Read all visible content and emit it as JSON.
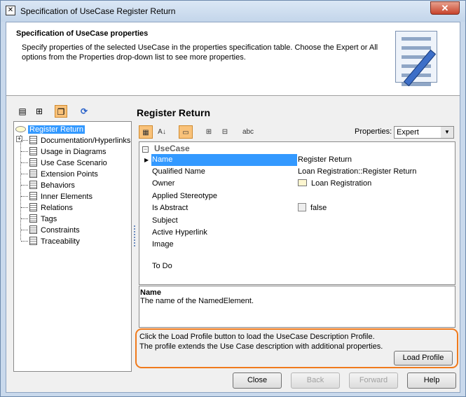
{
  "window": {
    "title": "Specification of UseCase Register Return",
    "close_label": "✕"
  },
  "header": {
    "title": "Specification of UseCase properties",
    "description": "Specify properties of the selected UseCase in the properties specification table. Choose the Expert or All options from the Properties drop-down list to see more properties."
  },
  "tree": {
    "root": "Register Return",
    "items": [
      "Documentation/Hyperlinks",
      "Usage in Diagrams",
      "Use Case Scenario",
      "Extension Points",
      "Behaviors",
      "Inner Elements",
      "Relations",
      "Tags",
      "Constraints",
      "Traceability"
    ]
  },
  "element_title": "Register Return",
  "properties": {
    "label": "Properties:",
    "selected": "Expert"
  },
  "table": {
    "group": "UseCase",
    "rows": [
      {
        "name": "Name",
        "value": "Register Return"
      },
      {
        "name": "Qualified Name",
        "value": "Loan Registration::Register Return"
      },
      {
        "name": "Owner",
        "value": "Loan Registration"
      },
      {
        "name": "Applied Stereotype",
        "value": ""
      },
      {
        "name": "Is Abstract",
        "value": "false"
      },
      {
        "name": "Subject",
        "value": ""
      },
      {
        "name": "Active Hyperlink",
        "value": ""
      },
      {
        "name": "Image",
        "value": ""
      },
      {
        "name": "To Do",
        "value": ""
      }
    ]
  },
  "description": {
    "title": "Name",
    "text": "The name of the NamedElement."
  },
  "profile": {
    "line1": "Click the Load Profile button to load the UseCase Description Profile.",
    "line2": "The profile extends the Use Case description with additional properties.",
    "button": "Load Profile"
  },
  "buttons": {
    "close": "Close",
    "back": "Back",
    "forward": "Forward",
    "help": "Help"
  },
  "colors": {
    "selection": "#3399ff",
    "highlight": "#f07a1c"
  }
}
